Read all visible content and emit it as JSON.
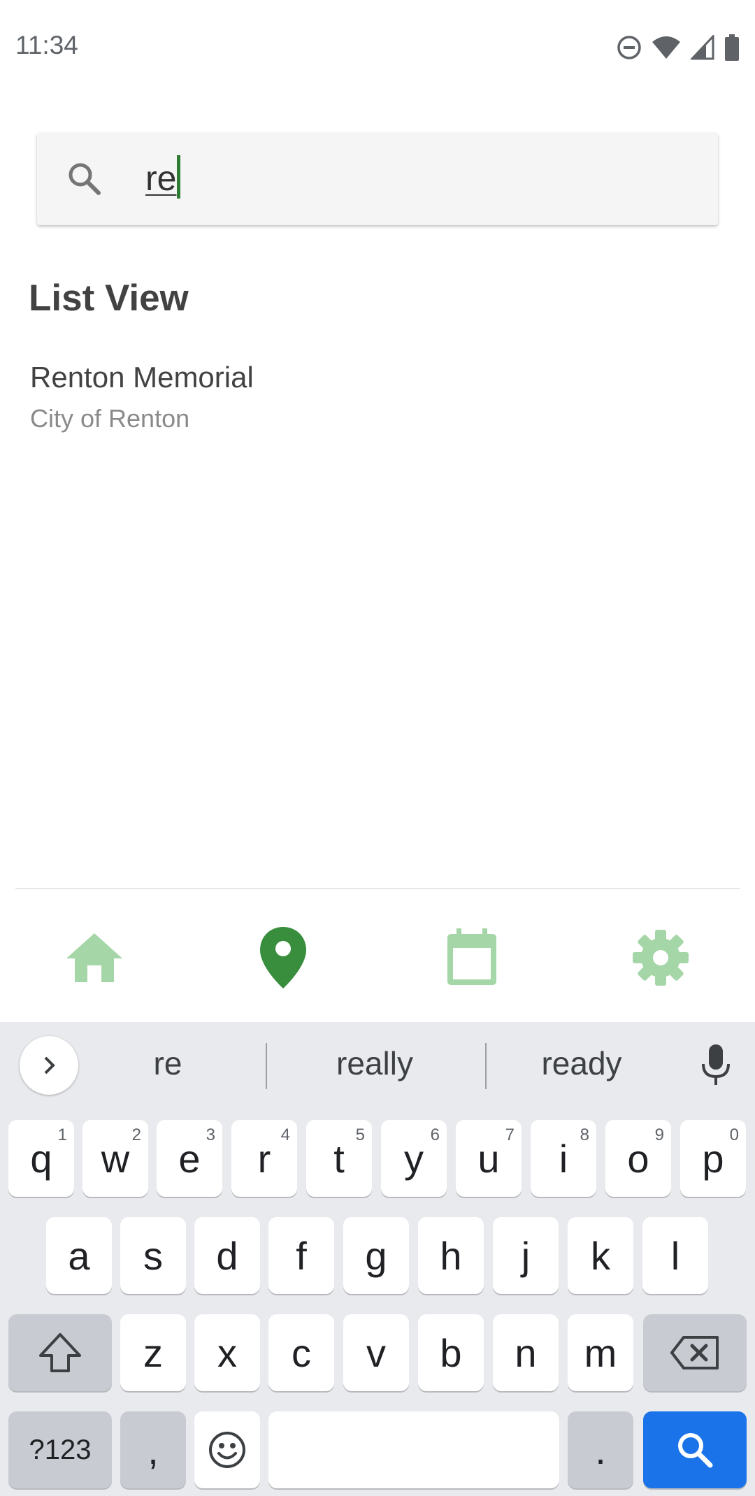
{
  "status_bar": {
    "time": "11:34"
  },
  "search": {
    "value": "re"
  },
  "list": {
    "heading": "List View",
    "items": [
      {
        "title": "Renton Memorial",
        "subtitle": "City of Renton"
      }
    ]
  },
  "bottom_nav": {
    "items": [
      {
        "icon": "home-icon",
        "active": false
      },
      {
        "icon": "location-pin-icon",
        "active": true
      },
      {
        "icon": "calendar-icon",
        "active": false
      },
      {
        "icon": "gear-icon",
        "active": false
      }
    ],
    "colors": {
      "active": "#388e3c",
      "inactive": "#a5d6a7"
    }
  },
  "keyboard": {
    "suggestions": [
      "re",
      "really",
      "ready"
    ],
    "row1": [
      "q",
      "w",
      "e",
      "r",
      "t",
      "y",
      "u",
      "i",
      "o",
      "p"
    ],
    "row1_hints": [
      "1",
      "2",
      "3",
      "4",
      "5",
      "6",
      "7",
      "8",
      "9",
      "0"
    ],
    "row2": [
      "a",
      "s",
      "d",
      "f",
      "g",
      "h",
      "j",
      "k",
      "l"
    ],
    "row3": [
      "z",
      "x",
      "c",
      "v",
      "b",
      "n",
      "m"
    ],
    "symbols_key": "?123",
    "comma_key": ",",
    "period_key": ".",
    "action_color": "#1a73e8"
  }
}
